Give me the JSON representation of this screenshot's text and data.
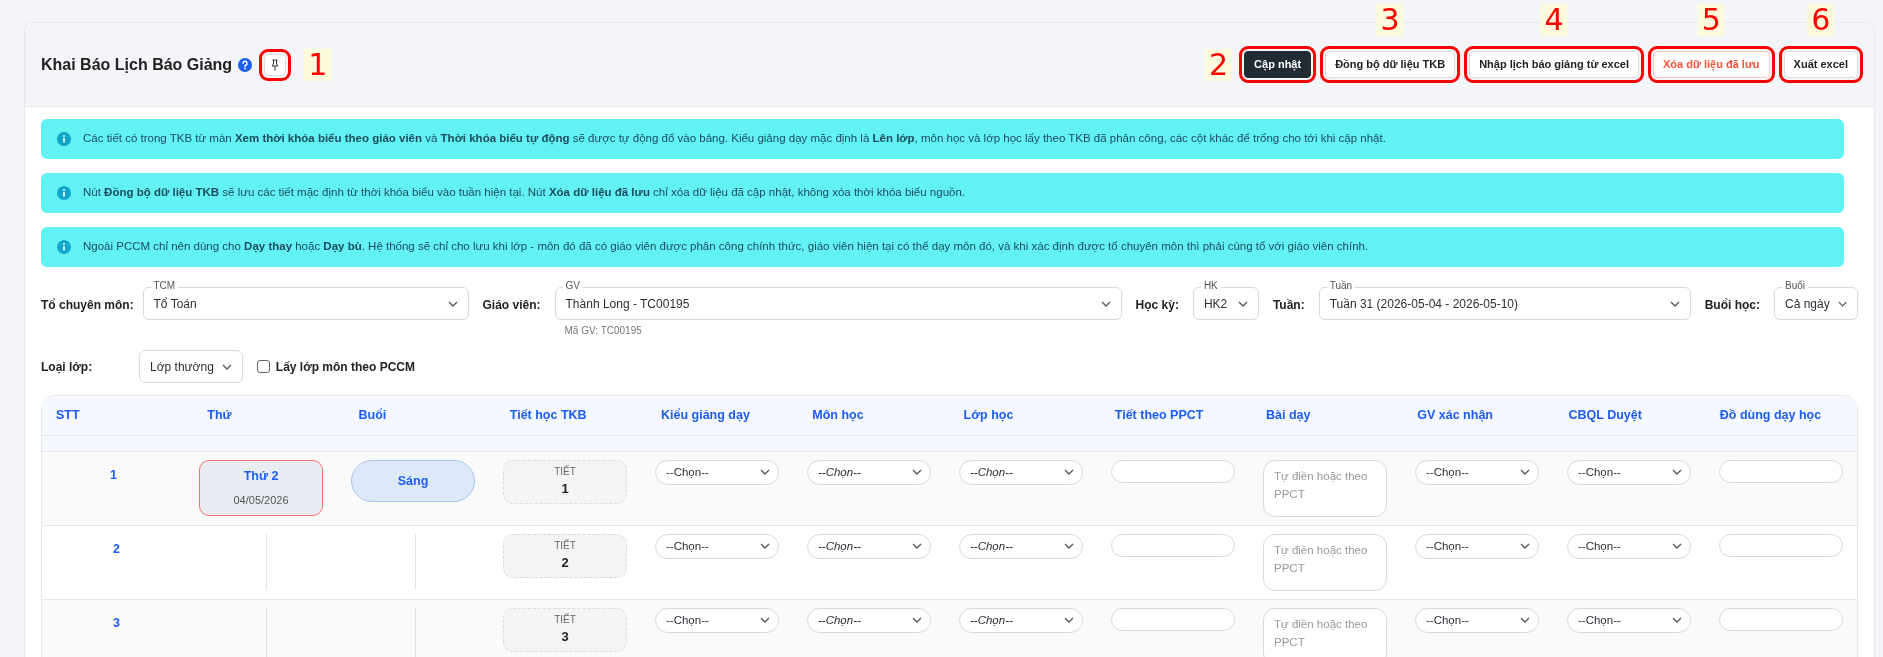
{
  "header": {
    "title": "Khai Báo Lịch Báo Giảng",
    "pin_callout": "1",
    "buttons": [
      {
        "label": "Cập nhật",
        "kind": "dark",
        "callout": "2"
      },
      {
        "label": "Đồng bộ dữ liệu TKB",
        "kind": "light",
        "callout": "3"
      },
      {
        "label": "Nhập lịch báo giảng từ excel",
        "kind": "light",
        "callout": "4"
      },
      {
        "label": "Xóa dữ liệu đã lưu",
        "kind": "danger",
        "callout": "5"
      },
      {
        "label": "Xuất excel",
        "kind": "light",
        "callout": "6"
      }
    ]
  },
  "notices": [
    "Các tiết có trong TKB từ màn **Xem thời khóa biểu theo giáo viên** và **Thời khóa biểu tự động** sẽ được tự động đổ vào bảng. Kiểu giảng dạy mặc định là **Lên lớp**, môn học và lớp học lấy theo TKB đã phân công, các cột khác để trống cho tới khi cập nhật.",
    "Nút **Đồng bộ dữ liệu TKB** sẽ lưu các tiết mặc định từ thời khóa biểu vào tuần hiện tại. Nút **Xóa dữ liệu đã lưu** chỉ xóa dữ liệu đã cập nhật, không xóa thời khóa biểu nguồn.",
    "Ngoài PCCM chỉ nên dùng cho **Dạy thay** hoặc **Dạy bù**. Hệ thống sẽ chỉ cho lưu khi lớp - môn đó đã có giáo viên được phân công chính thức, giáo viên hiện tại có thể dạy môn đó, và khi xác định được tổ chuyên môn thì phải cùng tổ với giáo viên chính."
  ],
  "filters": [
    {
      "label": "Tổ chuyên môn:",
      "float_label": "TCM",
      "value": "Tổ Toán"
    },
    {
      "label": "Giáo viên:",
      "float_label": "GV",
      "value": "Thành Long - TC00195",
      "helper": "Mã GV: TC00195"
    },
    {
      "label": "Học kỳ:",
      "float_label": "HK",
      "value": "HK2"
    },
    {
      "label": "Tuần:",
      "float_label": "Tuần",
      "value": "Tuần 31 (2026-05-04 - 2026-05-10)"
    },
    {
      "label": "Buổi học:",
      "float_label": "Buổi",
      "value": "Cả ngày"
    }
  ],
  "class_type": {
    "label": "Loại lớp:",
    "value": "Lớp thường"
  },
  "pccm_checkbox": {
    "label": "Lấy lớp môn theo PCCM",
    "checked": false
  },
  "table": {
    "columns": [
      "STT",
      "Thứ",
      "Buổi",
      "Tiết học TKB",
      "Kiểu giảng dạy",
      "Môn học",
      "Lớp học",
      "Tiết theo PPCT",
      "Bài dạy",
      "GV xác nhận",
      "CBQL Duyệt",
      "Đồ dùng dạy học"
    ],
    "rows": [
      {
        "cells": [
          {
            "kind": "number",
            "value": "1"
          },
          {
            "kind": "day",
            "label": "Thứ 2",
            "date": "04/05/2026",
            "highlighted": true
          },
          {
            "kind": "session",
            "value": "Sáng"
          },
          {
            "kind": "period",
            "label": "TIẾT",
            "value": "1"
          },
          {
            "kind": "select",
            "value": "--Chọn--",
            "italic": false
          },
          {
            "kind": "select",
            "value": "--Chọn--",
            "italic": true
          },
          {
            "kind": "select",
            "value": "--Chọn--",
            "italic": true
          },
          {
            "kind": "input"
          },
          {
            "kind": "textarea",
            "placeholder": "Tự điền hoặc theo PPCT"
          },
          {
            "kind": "select",
            "value": "--Chọn--",
            "italic": false
          },
          {
            "kind": "select",
            "value": "--Chọn--",
            "italic": false
          },
          {
            "kind": "input"
          }
        ]
      },
      {
        "cells": [
          {
            "kind": "number",
            "value": "2"
          },
          {
            "kind": "divider"
          },
          {
            "kind": "divider"
          },
          {
            "kind": "period",
            "label": "TIẾT",
            "value": "2"
          },
          {
            "kind": "select",
            "value": "--Chọn--",
            "italic": false
          },
          {
            "kind": "select",
            "value": "--Chọn--",
            "italic": true
          },
          {
            "kind": "select",
            "value": "--Chọn--",
            "italic": true
          },
          {
            "kind": "input"
          },
          {
            "kind": "textarea",
            "placeholder": "Tự điền hoặc theo PPCT"
          },
          {
            "kind": "select",
            "value": "--Chọn--",
            "italic": false
          },
          {
            "kind": "select",
            "value": "--Chọn--",
            "italic": false
          },
          {
            "kind": "input"
          }
        ]
      },
      {
        "cells": [
          {
            "kind": "number",
            "value": "3"
          },
          {
            "kind": "divider"
          },
          {
            "kind": "divider"
          },
          {
            "kind": "period",
            "label": "TIẾT",
            "value": "3"
          },
          {
            "kind": "select",
            "value": "--Chọn--",
            "italic": false
          },
          {
            "kind": "select",
            "value": "--Chọn--",
            "italic": true
          },
          {
            "kind": "select",
            "value": "--Chọn--",
            "italic": true
          },
          {
            "kind": "input"
          },
          {
            "kind": "textarea",
            "placeholder": "Tự điền hoặc theo PPCT"
          },
          {
            "kind": "select",
            "value": "--Chọn--",
            "italic": false
          },
          {
            "kind": "select",
            "value": "--Chọn--",
            "italic": false
          },
          {
            "kind": "input"
          }
        ]
      }
    ]
  }
}
